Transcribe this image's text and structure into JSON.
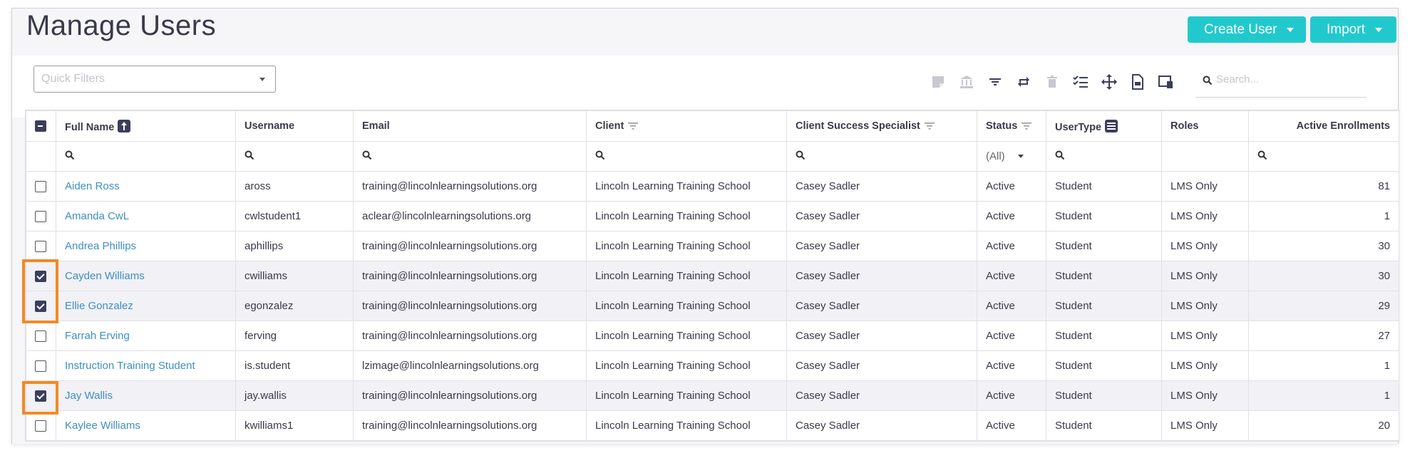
{
  "page": {
    "title": "Manage Users"
  },
  "header": {
    "create_label": "Create User",
    "import_label": "Import"
  },
  "filters": {
    "quick_placeholder": "Quick Filters",
    "search_placeholder": "Search..."
  },
  "toolbar_icons": [
    "note-icon",
    "bank-icon",
    "filter-lines-icon",
    "repeat-icon",
    "trash-icon",
    "checklist-icon",
    "move-icon",
    "export-file-icon",
    "device-icon"
  ],
  "columns": [
    "Full Name",
    "Username",
    "Email",
    "Client",
    "Client Success Specialist",
    "Status",
    "UserType",
    "Roles",
    "Active Enrollments"
  ],
  "status_filter": "(All)",
  "rows": [
    {
      "name": "Aiden Ross",
      "username": "aross",
      "email": "training@lincolnlearningsolutions.org",
      "client": "Lincoln Learning Training School",
      "css": "Casey Sadler",
      "status": "Active",
      "type": "Student",
      "roles": "LMS Only",
      "enroll": "81",
      "selected": false
    },
    {
      "name": "Amanda CwL",
      "username": "cwlstudent1",
      "email": "aclear@lincolnlearningsolutions.org",
      "client": "Lincoln Learning Training School",
      "css": "Casey Sadler",
      "status": "Active",
      "type": "Student",
      "roles": "LMS Only",
      "enroll": "1",
      "selected": false
    },
    {
      "name": "Andrea Phillips",
      "username": "aphillips",
      "email": "training@lincolnlearningsolutions.org",
      "client": "Lincoln Learning Training School",
      "css": "Casey Sadler",
      "status": "Active",
      "type": "Student",
      "roles": "LMS Only",
      "enroll": "30",
      "selected": false
    },
    {
      "name": "Cayden Williams",
      "username": "cwilliams",
      "email": "training@lincolnlearningsolutions.org",
      "client": "Lincoln Learning Training School",
      "css": "Casey Sadler",
      "status": "Active",
      "type": "Student",
      "roles": "LMS Only",
      "enroll": "30",
      "selected": true
    },
    {
      "name": "Ellie Gonzalez",
      "username": "egonzalez",
      "email": "training@lincolnlearningsolutions.org",
      "client": "Lincoln Learning Training School",
      "css": "Casey Sadler",
      "status": "Active",
      "type": "Student",
      "roles": "LMS Only",
      "enroll": "29",
      "selected": true
    },
    {
      "name": "Farrah Erving",
      "username": "ferving",
      "email": "training@lincolnlearningsolutions.org",
      "client": "Lincoln Learning Training School",
      "css": "Casey Sadler",
      "status": "Active",
      "type": "Student",
      "roles": "LMS Only",
      "enroll": "27",
      "selected": false
    },
    {
      "name": "Instruction Training Student",
      "username": "is.student",
      "email": "lzimage@lincolnlearningsolutions.org",
      "client": "Lincoln Learning Training School",
      "css": "Casey Sadler",
      "status": "Active",
      "type": "Student",
      "roles": "LMS Only",
      "enroll": "1",
      "selected": false
    },
    {
      "name": "Jay Wallis",
      "username": "jay.wallis",
      "email": "training@lincolnlearningsolutions.org",
      "client": "Lincoln Learning Training School",
      "css": "Casey Sadler",
      "status": "Active",
      "type": "Student",
      "roles": "LMS Only",
      "enroll": "1",
      "selected": true
    },
    {
      "name": "Kaylee Williams",
      "username": "kwilliams1",
      "email": "training@lincolnlearningsolutions.org",
      "client": "Lincoln Learning Training School",
      "css": "Casey Sadler",
      "status": "Active",
      "type": "Student",
      "roles": "LMS Only",
      "enroll": "20",
      "selected": false
    }
  ],
  "colors": {
    "accent": "#22c9cc",
    "link": "#3d8fc0",
    "highlight": "#f28a22",
    "checkbox": "#3b3f5c"
  }
}
